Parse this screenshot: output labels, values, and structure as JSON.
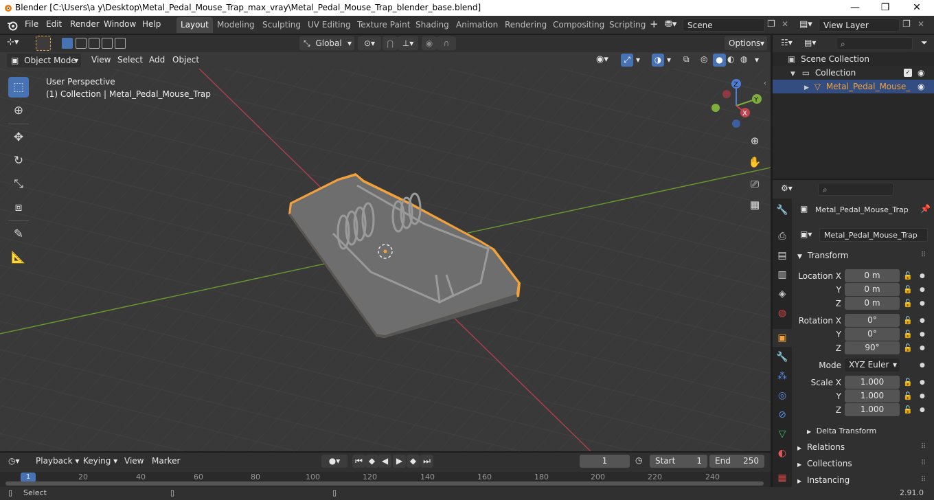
{
  "window": {
    "title": "Blender [C:\\Users\\a y\\Desktop\\Metal_Pedal_Mouse_Trap_max_vray\\Metal_Pedal_Mouse_Trap_blender_base.blend]",
    "minimize": "—",
    "maximize": "❐",
    "close": "✕"
  },
  "menubar": {
    "items": [
      "File",
      "Edit",
      "Render",
      "Window",
      "Help"
    ]
  },
  "workspaces": {
    "tabs": [
      "Layout",
      "Modeling",
      "Sculpting",
      "UV Editing",
      "Texture Paint",
      "Shading",
      "Animation",
      "Rendering",
      "Compositing",
      "Scripting"
    ],
    "active": "Layout",
    "add": "+"
  },
  "scene": {
    "name": "Scene"
  },
  "view_layer": {
    "name": "View Layer"
  },
  "toolbar": {
    "orientation": "Global",
    "options": "Options"
  },
  "viewport_header": {
    "mode": "Object Mode",
    "menus": [
      "View",
      "Select",
      "Add",
      "Object"
    ]
  },
  "viewport": {
    "perspective": "User Perspective",
    "collection_info": "(1) Collection | Metal_Pedal_Mouse_Trap",
    "gizmo": {
      "z": "Z",
      "y": "Y",
      "x": "X"
    }
  },
  "outliner": {
    "scene_collection": "Scene Collection",
    "collection": "Collection",
    "object": "Metal_Pedal_Mouse_"
  },
  "properties": {
    "object_name": "Metal_Pedal_Mouse_Trap",
    "object_field": "Metal_Pedal_Mouse_Trap",
    "transform_label": "Transform",
    "location_x_label": "Location X",
    "y_label": "Y",
    "z_label": "Z",
    "rotation_x_label": "Rotation X",
    "scale_x_label": "Scale X",
    "location": [
      "0 m",
      "0 m",
      "0 m"
    ],
    "rotation": [
      "0°",
      "0°",
      "90°"
    ],
    "mode_label": "Mode",
    "mode": "XYZ Euler",
    "scale": [
      "1.000",
      "1.000",
      "1.000"
    ],
    "delta_transform": "Delta Transform",
    "relations": "Relations",
    "collections": "Collections",
    "instancing": "Instancing"
  },
  "timeline": {
    "menus": [
      "Playback",
      "Keying",
      "View",
      "Marker"
    ],
    "current_frame": "1",
    "start_label": "Start",
    "start": "1",
    "end_label": "End",
    "end": "250",
    "ruler": [
      "1",
      "20",
      "40",
      "60",
      "80",
      "100",
      "120",
      "140",
      "160",
      "180",
      "200",
      "220",
      "240"
    ]
  },
  "status": {
    "left": "Select",
    "version": "2.91.0"
  },
  "colors": {
    "selection_orange": "#f2a23c",
    "active_blue": "#4772b3",
    "x_axis": "#c4414e",
    "y_axis": "#7fae3c",
    "z_axis": "#4f7ed9"
  }
}
